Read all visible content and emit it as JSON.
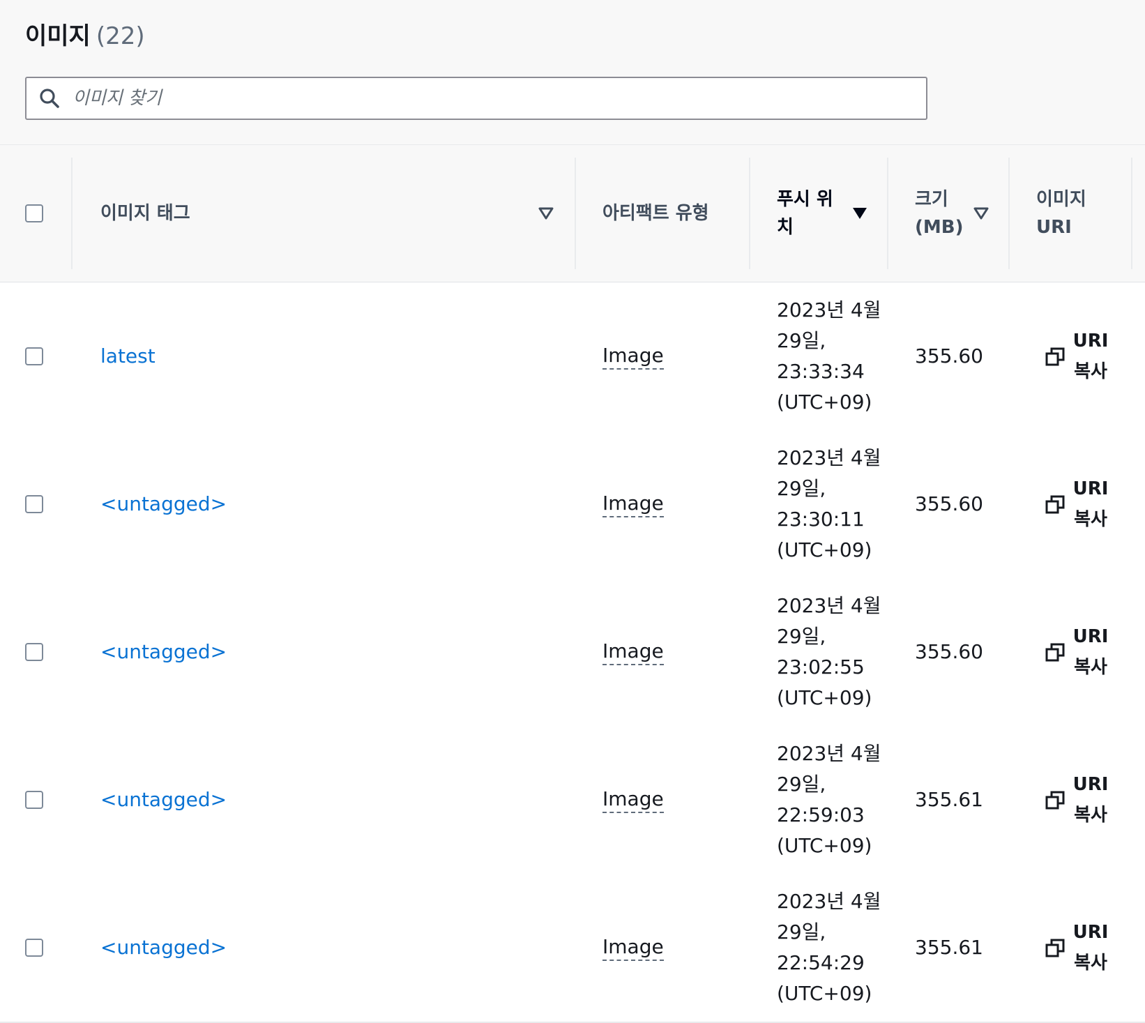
{
  "header": {
    "title": "이미지",
    "count": "(22)"
  },
  "search": {
    "placeholder": "이미지 찾기"
  },
  "columns": {
    "image_tag": "이미지 태그",
    "artifact_type": "아티팩트 유형",
    "pushed_at": "푸시 위치",
    "size": "크기 (MB)",
    "image_uri": "이미지 URI"
  },
  "rows": [
    {
      "tag": "latest",
      "artifact": "Image",
      "pushed": "2023년 4월 29일, 23:33:34 (UTC+09)",
      "size": "355.60",
      "copy": "URI 복사"
    },
    {
      "tag": "<untagged>",
      "artifact": "Image",
      "pushed": "2023년 4월 29일, 23:30:11 (UTC+09)",
      "size": "355.60",
      "copy": "URI 복사"
    },
    {
      "tag": "<untagged>",
      "artifact": "Image",
      "pushed": "2023년 4월 29일, 23:02:55 (UTC+09)",
      "size": "355.60",
      "copy": "URI 복사"
    },
    {
      "tag": "<untagged>",
      "artifact": "Image",
      "pushed": "2023년 4월 29일, 22:59:03 (UTC+09)",
      "size": "355.61",
      "copy": "URI 복사"
    },
    {
      "tag": "<untagged>",
      "artifact": "Image",
      "pushed": "2023년 4월 29일, 22:54:29 (UTC+09)",
      "size": "355.61",
      "copy": "URI 복사"
    }
  ],
  "icons": {
    "search": "search-icon",
    "sort_unsorted": "caret-down-outline-icon",
    "sort_active": "caret-down-filled-icon",
    "copy": "copy-icon"
  },
  "colors": {
    "link": "#0972d3",
    "header_bg": "#f8f8f8",
    "border": "#e9ebed"
  }
}
